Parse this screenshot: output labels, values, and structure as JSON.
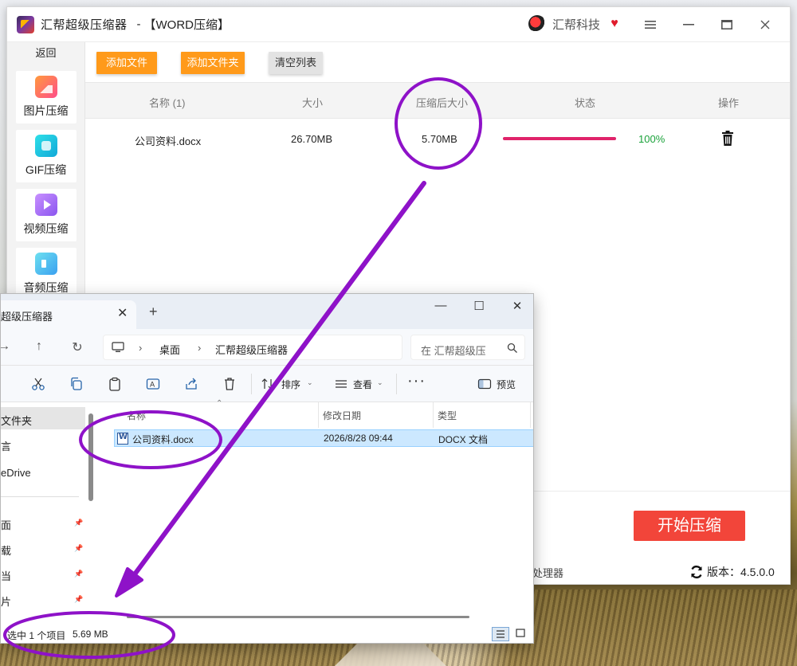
{
  "app": {
    "title": "汇帮超级压缩器",
    "separator": "-",
    "subtitle": "【WORD压缩】",
    "brand": "汇帮科技",
    "back": "返回",
    "sidebar": [
      {
        "label": "图片压缩",
        "icon": "image-icon"
      },
      {
        "label": "GIF压缩",
        "icon": "gif-icon"
      },
      {
        "label": "视频压缩",
        "icon": "video-icon"
      },
      {
        "label": "音频压缩",
        "icon": "audio-icon"
      }
    ],
    "toolbar": {
      "add_file": "添加文件",
      "add_folder": "添加文件夹",
      "clear_list": "清空列表"
    },
    "table": {
      "headers": [
        "名称 (1)",
        "大小",
        "压缩后大小",
        "状态",
        "操作"
      ],
      "rows": [
        {
          "name": "公司资料.docx",
          "size": "26.70MB",
          "compressed": "5.70MB",
          "progress": 100,
          "progress_label": "100%"
        }
      ]
    },
    "start_button": "开始压缩",
    "footer_left": "帮图片处理器",
    "version": "版本：4.5.0.0"
  },
  "explorer": {
    "tab_title": "超级压缩器",
    "breadcrumb": [
      "桌面",
      "汇帮超级压缩器"
    ],
    "search_placeholder": "在 汇帮超级压",
    "commands": {
      "sort": "排序",
      "view": "查看",
      "more": "···",
      "preview": "预览"
    },
    "nav": [
      {
        "label": "文件夹",
        "selected": true,
        "pinned": false
      },
      {
        "label": "言",
        "selected": false,
        "pinned": false
      },
      {
        "label": "eDrive",
        "selected": false,
        "pinned": false
      },
      {
        "label": "面",
        "selected": false,
        "pinned": true
      },
      {
        "label": "载",
        "selected": false,
        "pinned": true
      },
      {
        "label": "当",
        "selected": false,
        "pinned": true
      },
      {
        "label": "片",
        "selected": false,
        "pinned": true
      }
    ],
    "columns": [
      "名称",
      "修改日期",
      "类型"
    ],
    "files": [
      {
        "name": "公司资料.docx",
        "modified": "2026/8/28 09:44",
        "type": "DOCX 文档"
      }
    ],
    "status": "选中 1 个项目",
    "status_size": "5.69 MB"
  },
  "colors": {
    "accent_orange": "#ff9a1a",
    "start_red": "#f2453a",
    "progress_pink": "#e0236a",
    "success_green": "#1aa23a",
    "annotation_purple": "#8e12c8"
  }
}
